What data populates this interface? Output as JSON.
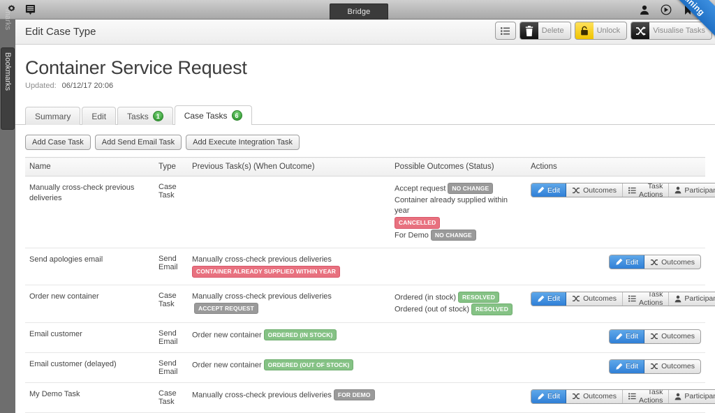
{
  "browser": {
    "tab_label": "Bridge",
    "left_icons": [
      {
        "name": "gear-icon"
      },
      {
        "name": "list-menu-icon"
      }
    ],
    "right_icons": [
      {
        "name": "user-person-icon"
      },
      {
        "name": "play-circle-icon"
      },
      {
        "name": "bookmark-flag-icon"
      }
    ]
  },
  "ribbon": {
    "label": "Training",
    "color": "#2f7fd6"
  },
  "sidebar": {
    "label": "Bookmarks",
    "ghost_label": "marks"
  },
  "header": {
    "title": "Edit Case Type",
    "actions": [
      {
        "name": "list-view-button",
        "icon": "list-icon",
        "label": ""
      },
      {
        "name": "delete-button",
        "icon": "trash-icon",
        "label": "Delete"
      },
      {
        "name": "unlock-button",
        "icon": "lock-icon",
        "label": "Unlock"
      },
      {
        "name": "visualise-tasks-button",
        "icon": "shuffle-icon",
        "label": "Visualise Tasks"
      }
    ]
  },
  "page": {
    "case_title": "Container Service Request",
    "updated_label": "Updated:",
    "updated_value": "06/12/17 20:06"
  },
  "tabs": [
    {
      "label": "Summary",
      "badge": "",
      "active": false
    },
    {
      "label": "Edit",
      "badge": "",
      "active": false
    },
    {
      "label": "Tasks",
      "badge": "1",
      "active": false
    },
    {
      "label": "Case Tasks",
      "badge": "6",
      "active": true
    }
  ],
  "add_buttons": [
    {
      "label": "Add Case Task"
    },
    {
      "label": "Add Send Email Task"
    },
    {
      "label": "Add Execute Integration Task"
    }
  ],
  "table": {
    "columns": [
      "Name",
      "Type",
      "Previous Task(s) (When Outcome)",
      "Possible Outcomes (Status)",
      "Actions"
    ],
    "rows": [
      {
        "name": "Manually cross-check previous deliveries",
        "type": "Case Task",
        "previous": [],
        "outcomes": [
          {
            "text": "Accept request",
            "badge": "NO CHANGE",
            "badge_color": "grey"
          },
          {
            "text": "Container already supplied within year",
            "badge": "CANCELLED",
            "badge_color": "red",
            "badge_wrap": true
          },
          {
            "text": "For Demo",
            "badge": "NO CHANGE",
            "badge_color": "grey"
          }
        ],
        "actions": [
          "Edit",
          "Outcomes",
          "Task Actions",
          "Participants"
        ]
      },
      {
        "name": "Send apologies email",
        "type": "Send Email",
        "previous": [
          {
            "text": "Manually cross-check previous deliveries",
            "badge": "CONTAINER ALREADY SUPPLIED WITHIN YEAR",
            "badge_color": "red",
            "badge_wrap": true
          }
        ],
        "outcomes": [],
        "actions": [
          "Edit",
          "Outcomes"
        ]
      },
      {
        "name": "Order new container",
        "type": "Case Task",
        "previous": [
          {
            "text": "Manually cross-check previous deliveries",
            "badge": "ACCEPT REQUEST",
            "badge_color": "grey"
          }
        ],
        "outcomes": [
          {
            "text": "Ordered (in stock)",
            "badge": "RESOLVED",
            "badge_color": "green"
          },
          {
            "text": "Ordered (out of stock)",
            "badge": "RESOLVED",
            "badge_color": "green"
          }
        ],
        "actions": [
          "Edit",
          "Outcomes",
          "Task Actions",
          "Participants"
        ]
      },
      {
        "name": "Email customer",
        "type": "Send Email",
        "previous": [
          {
            "text": "Order new container",
            "badge": "ORDERED (IN STOCK)",
            "badge_color": "green"
          }
        ],
        "outcomes": [],
        "actions": [
          "Edit",
          "Outcomes"
        ]
      },
      {
        "name": "Email customer (delayed)",
        "type": "Send Email",
        "previous": [
          {
            "text": "Order new container",
            "badge": "ORDERED (OUT OF STOCK)",
            "badge_color": "green"
          }
        ],
        "outcomes": [],
        "actions": [
          "Edit",
          "Outcomes"
        ]
      },
      {
        "name": "My Demo Task",
        "type": "Case Task",
        "previous": [
          {
            "text": "Manually cross-check previous deliveries",
            "badge": "FOR DEMO",
            "badge_color": "grey"
          }
        ],
        "outcomes": [],
        "actions": [
          "Edit",
          "Outcomes",
          "Task Actions",
          "Participants"
        ]
      }
    ]
  }
}
